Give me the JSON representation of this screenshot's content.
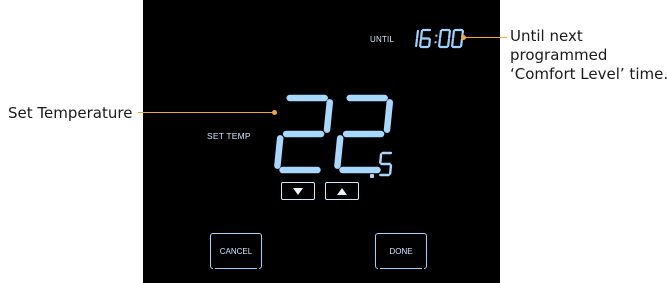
{
  "display": {
    "until_label": "UNTIL",
    "until_time": "16:00",
    "set_temp_label": "SET TEMP",
    "temp_whole": "22",
    "temp_decimal": "5"
  },
  "buttons": {
    "cancel_label": "CANCEL",
    "done_label": "DONE",
    "down_icon": "triangle-down-icon",
    "up_icon": "triangle-up-icon"
  },
  "callouts": {
    "right_line1": "Until next",
    "right_line2": "programmed",
    "right_line3": "‘Comfort Level’ time.",
    "left": "Set Temperature"
  },
  "colors": {
    "screen_bg": "#000000",
    "lcd_glow": "#9fd2ff",
    "leader": "#f0a830"
  }
}
